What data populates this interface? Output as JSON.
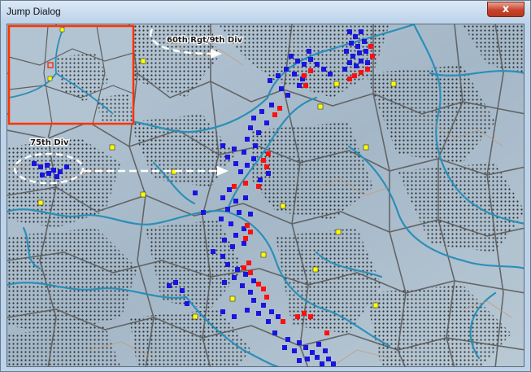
{
  "window": {
    "title": "Jump Dialog",
    "close_glyph": "x"
  },
  "map": {
    "labels": {
      "unit_top": "60th Rgt/9th Div",
      "unit_left": "75th Div"
    },
    "colors": {
      "friendly": "#1a14e0",
      "enemy": "#ff1010",
      "objective": "#ffff00",
      "river": "#2b8fb8",
      "border": "#5c5c5c",
      "minimap_frame": "#ff3300"
    }
  }
}
